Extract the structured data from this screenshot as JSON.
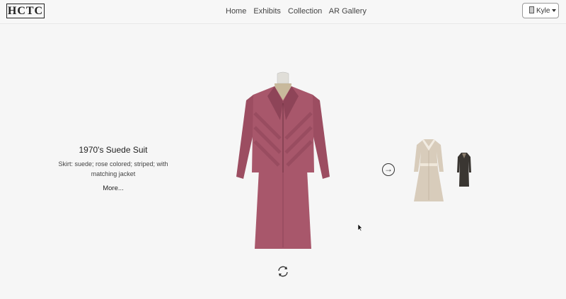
{
  "brand": {
    "logo_text": "HCTC"
  },
  "nav": {
    "items": [
      "Home",
      "Exhibits",
      "Collection",
      "AR Gallery"
    ]
  },
  "user": {
    "name": "Kyle"
  },
  "item": {
    "title": "1970's Suede Suit",
    "description": "Skirt: suede; rose colored; striped; with matching jacket",
    "more_label": "More..."
  },
  "icons": {
    "next": "arrow-right-circle-icon",
    "rotate": "rotate-icon",
    "user": "user-icon"
  },
  "colors": {
    "suit": "#a8576b",
    "suit_dark": "#8e4458",
    "background": "#f6f6f6"
  }
}
